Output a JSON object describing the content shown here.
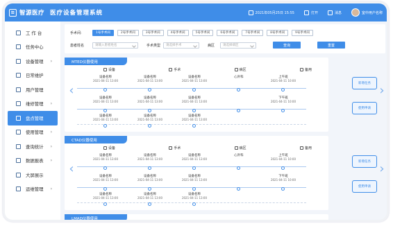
{
  "header": {
    "logo_text": "智源医疗",
    "system_title": "医疗设备管理系统",
    "datetime": "2021年05月25日 15:55",
    "open_label": "打开",
    "message_label": "消息",
    "user_label": "室中用户名称"
  },
  "sidebar": {
    "items": [
      {
        "label": "工 作 台",
        "arrow": ""
      },
      {
        "label": "任务中心",
        "arrow": ""
      },
      {
        "label": "设备管理",
        "arrow": "›"
      },
      {
        "label": "日常维护",
        "arrow": ""
      },
      {
        "label": "用户管理",
        "arrow": ""
      },
      {
        "label": "维修管理",
        "arrow": "›"
      },
      {
        "label": "盘点管理",
        "arrow": ""
      },
      {
        "label": "使用管理",
        "arrow": "›"
      },
      {
        "label": "查询统计",
        "arrow": "›"
      },
      {
        "label": "数据报表",
        "arrow": "›"
      },
      {
        "label": "大屏展示",
        "arrow": ""
      },
      {
        "label": "运维管理",
        "arrow": "›"
      }
    ]
  },
  "filter": {
    "room_label": "手术间:",
    "rooms": [
      "1号手术间",
      "2号手术间",
      "3号手术间",
      "4号手术间",
      "5号手术间",
      "6号手术间",
      "7号手术间",
      "8号手术间",
      "9号手术间"
    ],
    "patient_label": "患者姓名",
    "patient_placeholder": "请输入患者姓名",
    "surgery_label": "手术类型",
    "surgery_placeholder": "请选择手术",
    "ward_label": "病区",
    "ward_placeholder": "请选择病区",
    "search_label": "查询",
    "reset_label": "重置"
  },
  "panels": [
    {
      "title": "MTED仪器使用",
      "cats": [
        "设备",
        "手术",
        "病区",
        "备用"
      ],
      "row1": [
        {
          "name": "设备名称",
          "time": "2021-04-11 13:00"
        },
        {
          "name": "设备名称",
          "time": "2021-04-11 13:00"
        },
        {
          "name": "设备名称",
          "time": "2021-04-11 13:00"
        },
        {
          "name": "心外科",
          "time": ""
        },
        {
          "name": "上午班",
          "time": "2021-04-11 10:00"
        }
      ],
      "row2": [
        {
          "name": "设备名称",
          "time": "2021-04-11 13:00"
        },
        {
          "name": "设备名称",
          "time": "2021-04-11 13:00"
        },
        {
          "name": "设备名称",
          "time": "2021-04-11 13:00"
        },
        {
          "name": "",
          "time": ""
        },
        {
          "name": "下午班",
          "time": "2021-04-11 10:00"
        }
      ],
      "row3": [
        {
          "name": "设备名称",
          "time": "2021-04-11 13:00"
        },
        {
          "name": "设备名称",
          "time": "2021-04-11 13:00"
        },
        {
          "name": "设备名称",
          "time": "2021-04-11 13:00"
        }
      ],
      "btn1": "新增任务",
      "btn2": "使用申请"
    },
    {
      "title": "CTAD仪器使用",
      "cats": [
        "设备",
        "手术",
        "病区",
        "备用"
      ],
      "row1": [
        {
          "name": "设备名称",
          "time": "2021-04-11 13:00"
        },
        {
          "name": "设备名称",
          "time": "2021-04-11 13:00"
        },
        {
          "name": "设备名称",
          "time": "2021-04-11 13:00"
        },
        {
          "name": "心外科",
          "time": ""
        },
        {
          "name": "上午班",
          "time": "2021-04-11 10:00"
        }
      ],
      "row2": [
        {
          "name": "设备名称",
          "time": "2021-04-11 13:00"
        },
        {
          "name": "设备名称",
          "time": "2021-04-11 13:00"
        },
        {
          "name": "设备名称",
          "time": "2021-04-11 13:00"
        },
        {
          "name": "",
          "time": ""
        },
        {
          "name": "下午班",
          "time": "2021-04-11 10:00"
        }
      ],
      "row3": [
        {
          "name": "设备名称",
          "time": "2021-04-11 13:00"
        },
        {
          "name": "设备名称",
          "time": "2021-04-11 13:00"
        },
        {
          "name": "设备名称",
          "time": "2021-04-11 13:00"
        }
      ],
      "btn1": "新增任务",
      "btn2": "使用申请"
    },
    {
      "title": "LMAD仪器使用"
    }
  ]
}
